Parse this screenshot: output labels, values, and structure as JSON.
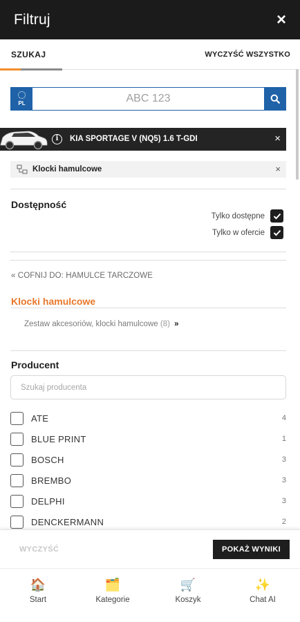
{
  "header": {
    "title": "Filtruj",
    "close_symbol": "×"
  },
  "tabs": {
    "search_label": "SZUKAJ",
    "clear_all_label": "WYCZYŚĆ WSZYSTKO"
  },
  "plate": {
    "country": "PL",
    "placeholder": "ABC 123"
  },
  "vehicle": {
    "name": "KIA SPORTAGE V (NQ5) 1.6 T-GDI",
    "info_symbol": "i",
    "close_symbol": "×"
  },
  "category_chip": {
    "label": "Klocki hamulcowe",
    "close_symbol": "×"
  },
  "availability": {
    "title": "Dostępność",
    "options": [
      {
        "label": "Tylko dostępne",
        "checked": true
      },
      {
        "label": "Tylko w ofercie",
        "checked": true
      }
    ]
  },
  "category_nav": {
    "back_label": "COFNIJ DO: HAMULCE TARCZOWE",
    "back_symbol": "«",
    "current": "Klocki hamulcowe",
    "subcategory": {
      "label": "Zestaw akcesoriów, klocki hamulcowe",
      "count": "(8)",
      "arrow_symbol": "»"
    }
  },
  "producer": {
    "title": "Producent",
    "search_placeholder": "Szukaj producenta",
    "items": [
      {
        "name": "ATE",
        "count": "4"
      },
      {
        "name": "BLUE PRINT",
        "count": "1"
      },
      {
        "name": "BOSCH",
        "count": "3"
      },
      {
        "name": "BREMBO",
        "count": "3"
      },
      {
        "name": "DELPHI",
        "count": "3"
      },
      {
        "name": "DENCKERMANN",
        "count": "2"
      }
    ]
  },
  "actions": {
    "clear_label": "WYCZYŚĆ",
    "show_results_label": "POKAŻ WYNIKI"
  },
  "bottom_nav": [
    {
      "label": "Start",
      "icon": "home-icon",
      "glyph": "🏠"
    },
    {
      "label": "Kategorie",
      "icon": "folder-icon",
      "glyph": "🗂️"
    },
    {
      "label": "Koszyk",
      "icon": "cart-icon",
      "glyph": "🛒"
    },
    {
      "label": "Chat AI",
      "icon": "sparkles-icon",
      "glyph": "✨"
    }
  ],
  "colors": {
    "header_bg": "#1b1b1b",
    "accent_orange": "#e8782a",
    "plate_blue": "#1f62a8",
    "car_bar_bg": "#242424"
  }
}
